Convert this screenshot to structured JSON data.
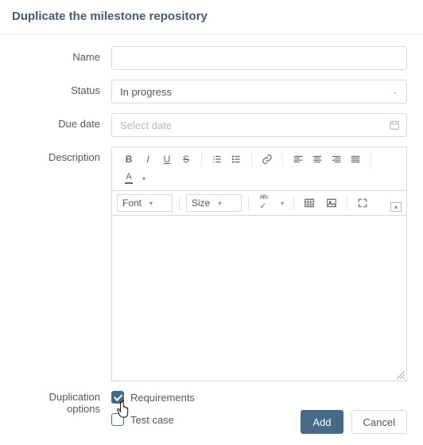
{
  "header": {
    "title": "Duplicate the milestone repository"
  },
  "labels": {
    "name": "Name",
    "status": "Status",
    "due_date": "Due date",
    "description": "Description",
    "dup_options": "Duplication options"
  },
  "name": {
    "value": ""
  },
  "status": {
    "value": "In progress"
  },
  "due_date": {
    "placeholder": "Select date"
  },
  "editor": {
    "font_label": "Font",
    "size_label": "Size"
  },
  "dup_options": {
    "requirements": {
      "label": "Requirements",
      "checked": true
    },
    "test_case": {
      "label": "Test case",
      "checked": false
    }
  },
  "footer": {
    "add": "Add",
    "cancel": "Cancel"
  }
}
